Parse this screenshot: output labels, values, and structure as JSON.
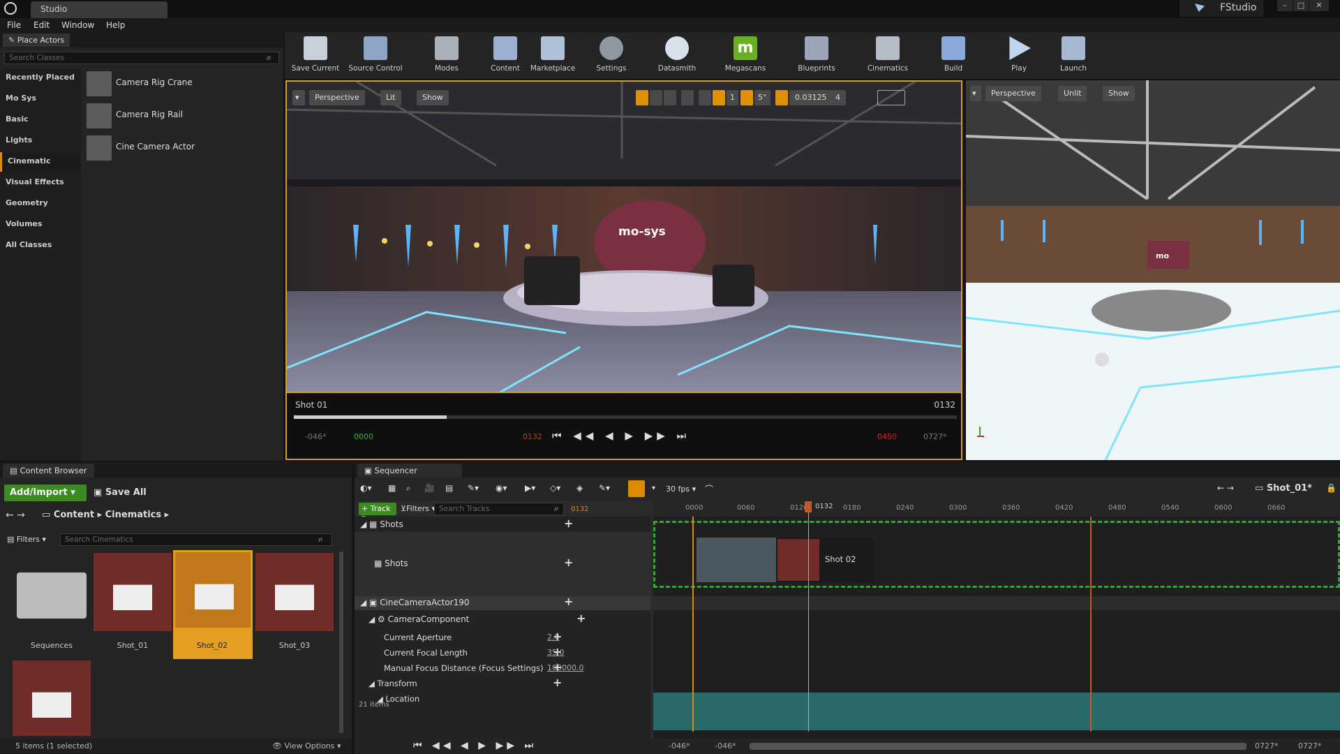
{
  "app": {
    "doc_tab": "Studio",
    "project": "FStudio"
  },
  "menu": [
    "File",
    "Edit",
    "Window",
    "Help"
  ],
  "place_actors": {
    "tab": "Place Actors",
    "search_placeholder": "Search Classes",
    "categories": [
      "Recently Placed",
      "Mo Sys",
      "Basic",
      "Lights",
      "Cinematic",
      "Visual Effects",
      "Geometry",
      "Volumes",
      "All Classes"
    ],
    "active_category": "Cinematic",
    "actors": [
      "Camera Rig Crane",
      "Camera Rig Rail",
      "Cine Camera Actor"
    ]
  },
  "toolbar": [
    {
      "label": "Save Current",
      "icon": "save-icon"
    },
    {
      "label": "Source Control",
      "icon": "source-control-icon"
    },
    {
      "label": "Modes",
      "icon": "modes-icon"
    },
    {
      "label": "Content",
      "icon": "content-icon"
    },
    {
      "label": "Marketplace",
      "icon": "marketplace-icon"
    },
    {
      "label": "Settings",
      "icon": "settings-icon"
    },
    {
      "label": "Datasmith",
      "icon": "datasmith-icon"
    },
    {
      "label": "Megascans",
      "icon": "megascans-icon"
    },
    {
      "label": "Blueprints",
      "icon": "blueprints-icon"
    },
    {
      "label": "Cinematics",
      "icon": "cinematics-icon"
    },
    {
      "label": "Build",
      "icon": "build-icon"
    },
    {
      "label": "Play",
      "icon": "play-icon"
    },
    {
      "label": "Launch",
      "icon": "launch-icon"
    }
  ],
  "viewport_main": {
    "perspective": "Perspective",
    "lit": "Lit",
    "show": "Show",
    "grid_size": "1",
    "angle": "5°",
    "scale": "0.03125",
    "cam_speed": "4",
    "logo_text": "mo-sys"
  },
  "player": {
    "shot": "Shot 01",
    "frame_right": "0132",
    "start": "-046*",
    "current": "0000",
    "mark": "0132",
    "end_red": "0450",
    "end": "0727*",
    "progress": 0.23
  },
  "viewport_side": {
    "perspective": "Perspective",
    "unlit": "Unlit",
    "show": "Show",
    "logo_text": "mo"
  },
  "content_browser": {
    "tab": "Content Browser",
    "add_import": "Add/Import",
    "save_all": "Save All",
    "path": [
      "Content",
      "Cinematics"
    ],
    "filters": "Filters",
    "search_placeholder": "Search Cinematics",
    "assets": [
      {
        "name": "Sequences",
        "type": "folder"
      },
      {
        "name": "Shot_01",
        "type": "sequence"
      },
      {
        "name": "Shot_02",
        "type": "sequence",
        "selected": true
      },
      {
        "name": "Shot_03",
        "type": "sequence"
      },
      {
        "name": "",
        "type": "sequence"
      }
    ],
    "status": "5 items (1 selected)",
    "view_options": "View Options"
  },
  "sequencer": {
    "tab": "Sequencer",
    "fps": "30 fps",
    "breadcrumb": "Shot_01*",
    "track_btn": "Track",
    "filters": "Filters",
    "search_placeholder": "Search Tracks",
    "current_frame": "0132",
    "tracks": {
      "shots_folder": "Shots",
      "shots_track": "Shots",
      "camera_actor": "CineCameraActor190",
      "camera_component": "CameraComponent",
      "props": [
        {
          "label": "Current Aperture",
          "value": "2.8"
        },
        {
          "label": "Current Focal Length",
          "value": "35.0"
        },
        {
          "label": "Manual Focus Distance (Focus Settings)",
          "value": "100000.0"
        }
      ],
      "transform": "Transform",
      "location": "Location",
      "items_count": "21 items"
    },
    "ruler": [
      "0000",
      "0060",
      "0120",
      "0180",
      "0240",
      "0300",
      "0360",
      "0420",
      "0480",
      "0540",
      "0600",
      "0660"
    ],
    "playhead_label": "0132",
    "shot_clip": "Shot 02",
    "range_start": "-046*",
    "range_start2": "-046*",
    "range_end": "0727*",
    "range_end2": "0727*"
  }
}
